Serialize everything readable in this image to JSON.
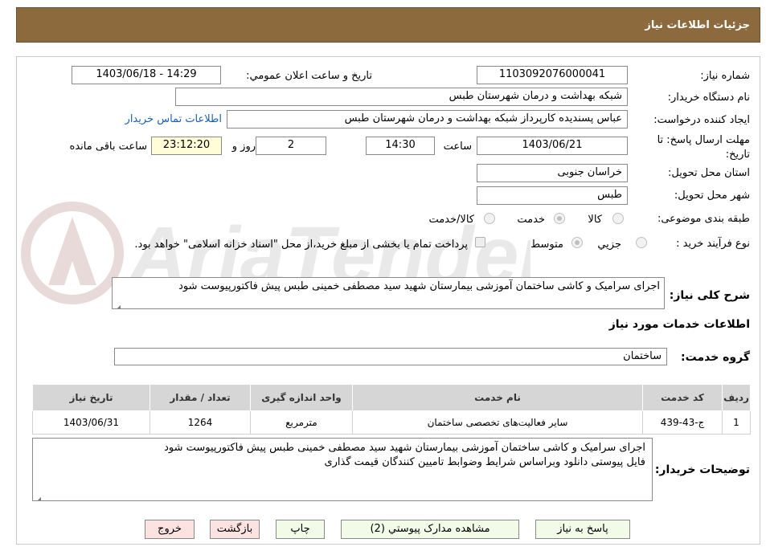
{
  "header": {
    "title": "جزئیات اطلاعات نیاز"
  },
  "fields": {
    "need_number_label": "شماره نیاز:",
    "need_number": "1103092076000041",
    "announce_label": "تاریخ و ساعت اعلان عمومي:",
    "announce_value": "1403/06/18 - 14:29",
    "buyer_org_label": "نام دستگاه خريدار:",
    "buyer_org": "شبکه بهداشت و درمان شهرستان طبس",
    "requester_label": "ايجاد کننده درخواست:",
    "requester": "عباس پسندیده کارپرداز شبکه بهداشت و درمان شهرستان طبس",
    "contact_link": "اطلاعات تماس خريدار",
    "deadline_label": "مهلت ارسال پاسخ: تا تاریخ:",
    "deadline_date": "1403/06/21",
    "time_label": "ساعت",
    "deadline_time": "14:30",
    "days": "2",
    "days_label": "روز و",
    "remaining_time": "23:12:20",
    "remaining_label": "ساعت باقی مانده",
    "province_label": "استان محل تحويل:",
    "province": "خراسان جنوبی",
    "city_label": "شهر محل تحويل:",
    "city": "طبس",
    "category_label": "طبقه بندی موضوعی:",
    "category_options": [
      "کالا",
      "خدمت",
      "کالا/خدمت"
    ],
    "category_selected": "خدمت",
    "process_label": "نوع فرآيند خريد :",
    "process_options": [
      "جزیي",
      "متوسط"
    ],
    "process_selected": "متوسط",
    "payment_note": "پرداخت تمام یا بخشی از مبلغ خرید،از محل \"اسناد خزانه اسلامی\" خواهد بود."
  },
  "description": {
    "label": "شرح کلی نیاز:",
    "text": "اجرای  سرامیک و کاشی ساختمان آموزشی بیمارستان شهید سید مصطفی خمینی طبس پیش فاکتورپیوست شود"
  },
  "services": {
    "section_title": "اطلاعات خدمات مورد نياز",
    "group_label": "گروه خدمت:",
    "group_value": "ساختمان",
    "columns": [
      "رديف",
      "کد خدمت",
      "نام خدمت",
      "واحد اندازه گيری",
      "تعداد / مقدار",
      "تاريخ نياز"
    ],
    "rows": [
      [
        "1",
        "ج-43-439",
        "ساير فعاليت‌های تخصصی ساختمان",
        "مترمربع",
        "1264",
        "1403/06/31"
      ]
    ]
  },
  "buyer_notes": {
    "label": "توضیحات خریدار:",
    "line1": "اجرای  سرامیک و کاشی ساختمان آموزشی بیمارستان شهید سید مصطفی خمینی طبس پیش فاکتورپیوست شود",
    "line2": "فایل پیوستی دانلود وبراساس شرایط وضوابط تامیین کنندگان قیمت گذاری"
  },
  "buttons": {
    "reply": "پاسخ به نياز",
    "docs": "مشاهده مدارک پيوستي (2)",
    "print": "چاپ",
    "back": "بازگشت",
    "exit": "خروج"
  },
  "watermark": "AriaTender.neT",
  "colors": {
    "header_bg": "#8c6a3e",
    "time_bg": "#fffcd8",
    "link": "#1a5fb4",
    "table_head": "#d6d6d6",
    "button_green": "#f2fbe8",
    "button_red": "#fde2e2"
  }
}
